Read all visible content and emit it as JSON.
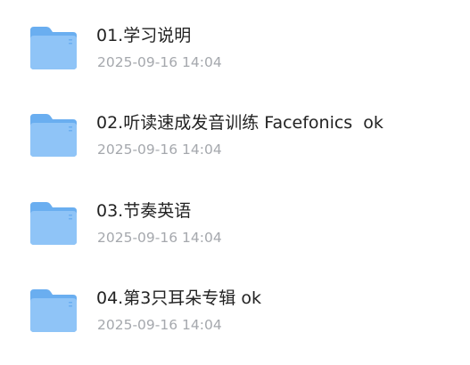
{
  "files": [
    {
      "name": "01.学习说明",
      "date": "2025-09-16 14:04",
      "icon": "folder-icon"
    },
    {
      "name": "02.听读速成发音训练 Facefonics  ok",
      "date": "2025-09-16 14:04",
      "icon": "folder-icon"
    },
    {
      "name": "03.节奏英语",
      "date": "2025-09-16 14:04",
      "icon": "folder-icon"
    },
    {
      "name": "04.第3只耳朵专辑 ok",
      "date": "2025-09-16 14:04",
      "icon": "folder-icon"
    }
  ],
  "colors": {
    "folder_back": "#6aaef0",
    "folder_front": "#8fc4f7",
    "title": "#222222",
    "date": "#a5a8ad"
  }
}
